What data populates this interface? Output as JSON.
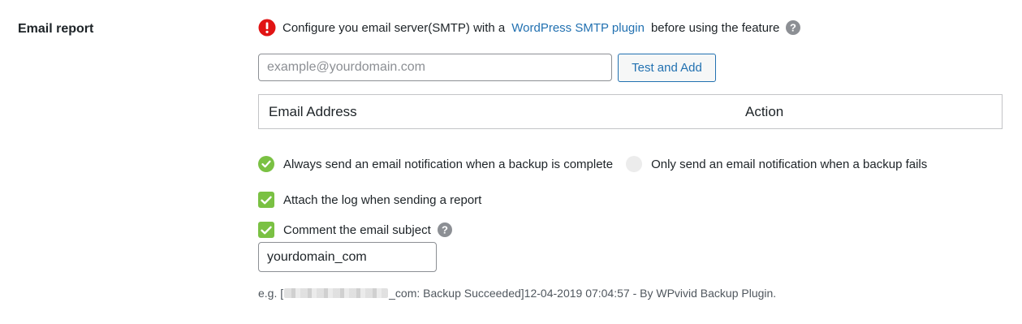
{
  "section": {
    "label": "Email report"
  },
  "notice": {
    "icon": "error-icon",
    "text_before": "Configure you email server(SMTP) with a",
    "link_text": "WordPress SMTP plugin",
    "text_after": "before using the feature",
    "help_icon": "question-circle-icon"
  },
  "email_field": {
    "placeholder": "example@yourdomain.com",
    "value": ""
  },
  "test_button": {
    "label": "Test and Add"
  },
  "table": {
    "columns": [
      "Email Address",
      "Action"
    ],
    "rows": []
  },
  "notification_options": {
    "always": {
      "label": "Always send an email notification when a backup is complete",
      "selected": true
    },
    "fails": {
      "label": "Only send an email notification when a backup fails",
      "selected": false
    }
  },
  "attach_log": {
    "label": "Attach the log when sending a report",
    "checked": true
  },
  "comment_subject": {
    "label": "Comment the email subject",
    "checked": true,
    "help_icon": "question-circle-icon",
    "value": "yourdomain_com"
  },
  "example": {
    "prefix": "e.g. [",
    "suffix": "_com: Backup Succeeded]12-04-2019 07:04:57 - By WPvivid Backup Plugin."
  },
  "colors": {
    "accent_green": "#7ac143",
    "link_blue": "#2271b1",
    "error_red": "#d63638"
  }
}
